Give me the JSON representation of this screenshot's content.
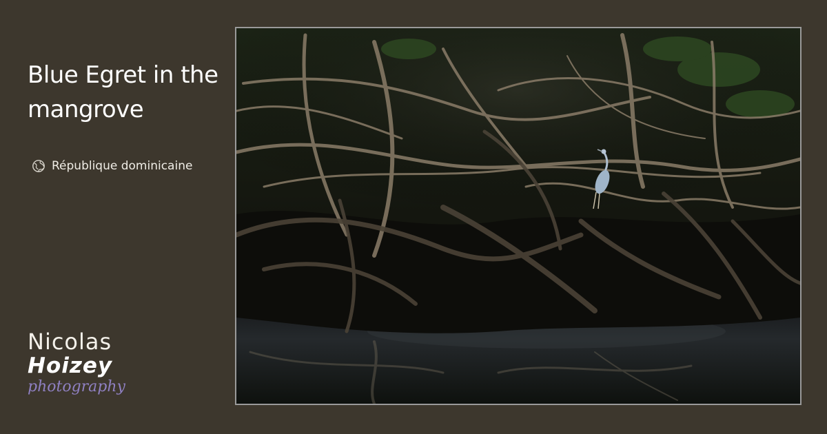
{
  "page": {
    "title": "Blue Egret in the mangrove",
    "location": {
      "icon": "globe-icon",
      "text": "République dominicaine"
    }
  },
  "logo": {
    "first_name": "Nicolas",
    "last_name": "Hoizey",
    "tagline": "photography",
    "tagline_color": "#8f80c2"
  },
  "photo": {
    "subject": "blue egret perched among mangrove roots above dark water"
  },
  "colors": {
    "background": "#3d372d",
    "frame_border": "#9a9a9a",
    "text": "#ffffff"
  }
}
